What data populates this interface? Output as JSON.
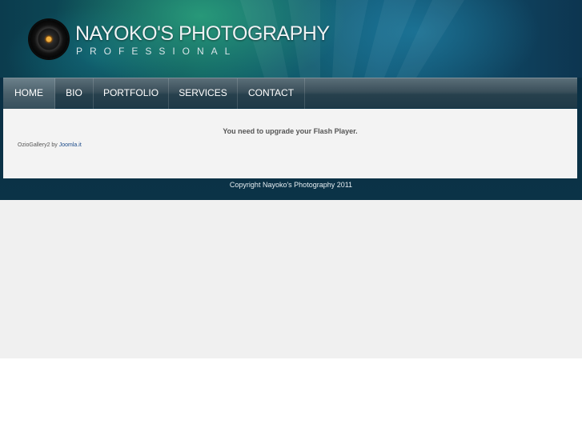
{
  "header": {
    "title": "NAYOKO'S PHOTOGRAPHY",
    "subtitle": "PROFESSIONAL",
    "logo_icon": "camera-lens-icon"
  },
  "nav": {
    "items": [
      {
        "label": "HOME",
        "active": true
      },
      {
        "label": "BIO"
      },
      {
        "label": "PORTFOLIO"
      },
      {
        "label": "SERVICES"
      },
      {
        "label": "CONTACT"
      }
    ]
  },
  "content": {
    "flash_message": "You need to upgrade your Flash Player.",
    "credit_prefix": "OzioGallery2 by",
    "credit_link": "Joomla.it"
  },
  "footer": {
    "copyright": "Copyright Nayoko's Photography 2011"
  },
  "colors": {
    "header_dark": "#0b3347",
    "nav_bar": "#27404d",
    "content_bg": "#f3f3f3",
    "page_gray": "#f0f0f0"
  }
}
